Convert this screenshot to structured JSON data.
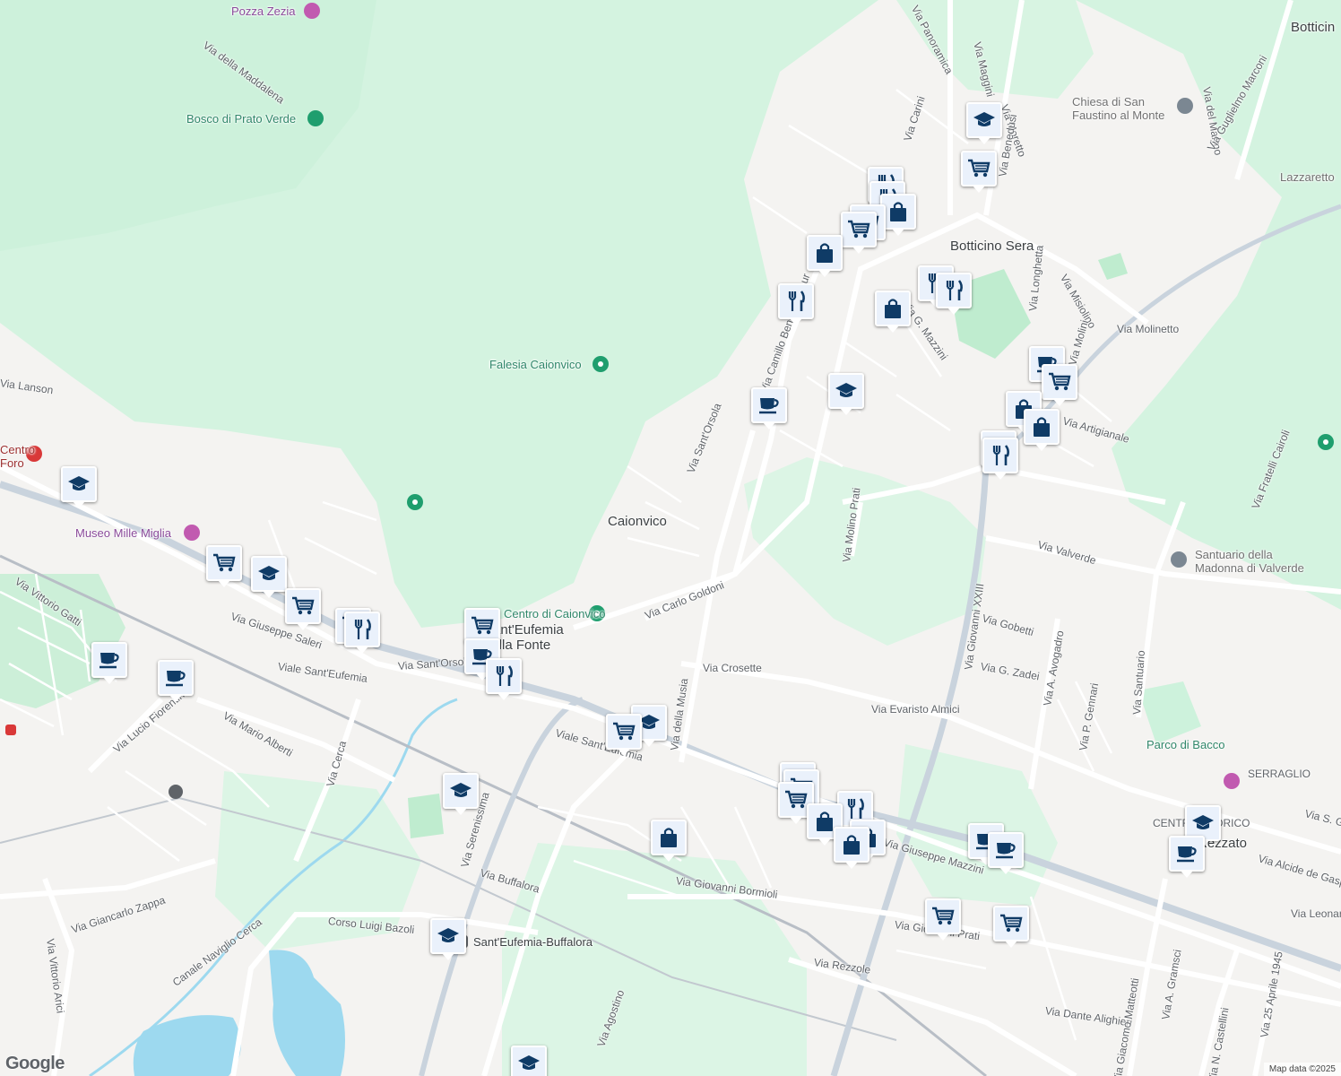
{
  "map": {
    "attribution": "Map data ©2025",
    "logo": "Google",
    "colors": {
      "land": "#f4f3f1",
      "park": "#cdf2dc",
      "forest": "#d6f3e1",
      "water": "#9dd9ef",
      "road": "#ffffff",
      "road_casing": "#dadce0",
      "highway": "#c6d0da",
      "marker_fill": "#eaf1fb",
      "marker_icon": "#0f3b66"
    }
  },
  "places": [
    {
      "id": "botticino",
      "text": "Botticino Sera"
    },
    {
      "id": "caionvico",
      "text": "Caionvico"
    },
    {
      "id": "santeufemia",
      "text": "Sant'Eufemia\ndella Fonte"
    },
    {
      "id": "botticin-edge",
      "text": "Botticin"
    },
    {
      "id": "centro-storico",
      "text": "CENTRO STORICO"
    },
    {
      "id": "rezzato",
      "text": "Rezzato"
    },
    {
      "id": "serraglio",
      "text": "SERRAGLIO"
    },
    {
      "id": "lazzaretto",
      "text": "Lazzaretto"
    }
  ],
  "pois": [
    {
      "id": "pozza-zezia",
      "text": "Pozza Zezia",
      "icon": "camera-icon"
    },
    {
      "id": "bosco",
      "text": "Bosco di Prato Verde",
      "icon": "tree-icon"
    },
    {
      "id": "falesia",
      "text": "Falesia Caionvico",
      "icon": "pin-icon"
    },
    {
      "id": "chiesa",
      "text": "Chiesa di San\nFaustino al Monte",
      "icon": "cross-icon"
    },
    {
      "id": "museo",
      "text": "Museo Mille Miglia",
      "icon": "museum-icon"
    },
    {
      "id": "centro-caionvico",
      "text": "Centro di Caionvico",
      "icon": "pin-icon"
    },
    {
      "id": "santuario",
      "text": "Santuario della\nMadonna di Valverde",
      "icon": "church-icon"
    },
    {
      "id": "parco-bacco",
      "text": "Parco di Bacco",
      "icon": "park-icon"
    },
    {
      "id": "stazione",
      "text": "Sant'Eufemia-Buffalora",
      "icon": "metro-icon"
    },
    {
      "id": "ospedale",
      "text": "Centro\nForo",
      "icon": "hospital-icon"
    }
  ],
  "streets": [
    "Via della Maddalena",
    "Via Panoramica",
    "Via Maggini",
    "Via Moretto",
    "Via Carini",
    "Via Benedusi",
    "Via del Marmo",
    "Via Guglielmo Marconi",
    "Via Camillo Benso Cavour",
    "Via G. Mazzini",
    "Via Misiolino",
    "Via Molinetto",
    "Via Longhetta",
    "Via Molini",
    "Via Artigianale",
    "Via Sant'Orsola",
    "Via Molino Prati",
    "Via Fratelli Cairoli",
    "Via Valverde",
    "Via Carlo Goldoni",
    "Via Giovanni XXIII",
    "Via Gobetti",
    "Via G. Zadei",
    "Via A. Avogadro",
    "Via Santuario",
    "Via Crosette",
    "Via Evaristo Almici",
    "Via P. Gennari",
    "Via della Musia",
    "Via Giuseppe Saleri",
    "Viale Sant'Eufemia",
    "Via Sant'Orsola",
    "Via Vittorio Gatti",
    "Via Mario Alberti",
    "Via Lucio Fiorentini",
    "Via Cerca",
    "Via Serenissima",
    "Via Buffalora",
    "Via Giovanni Bormioli",
    "Via Giuseppe Mazzini",
    "Via Giovanni Prati",
    "Via Rezzole",
    "Corso Luigi Bazoli",
    "Canale Naviglio Cerca",
    "Via Giancarlo Zappa",
    "Via Vittorio Arici",
    "Via Dante Alighieri",
    "Via Giacomo Matteotti",
    "Via A. Gramsci",
    "Via N. Castellini",
    "Via 25 Aprile 1945",
    "Via Alcide de Gasperi",
    "Via Leonardo",
    "Via S. Ga",
    "Via Agostino",
    "Via Lanson",
    "Viale Sant'Eufemia"
  ]
}
